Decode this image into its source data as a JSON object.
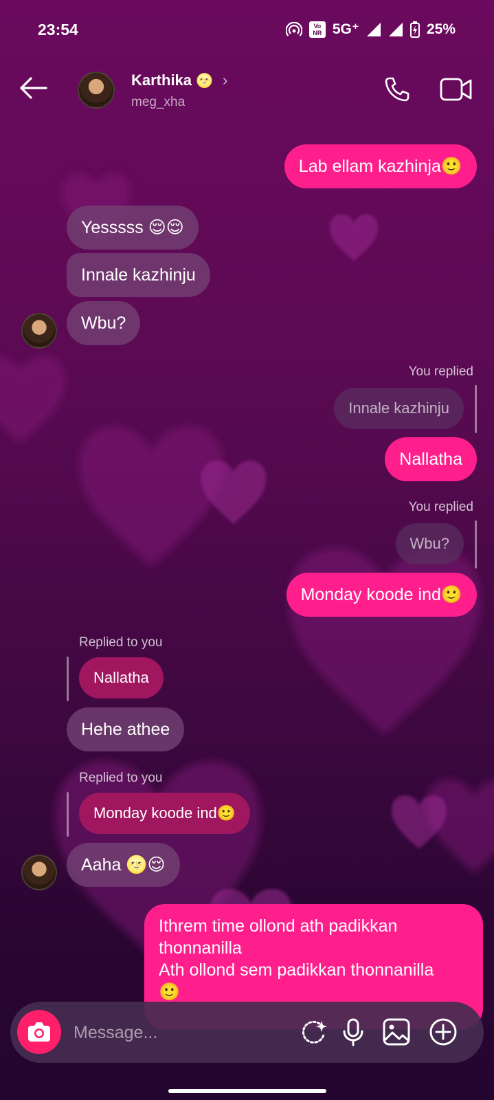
{
  "status": {
    "time": "23:54",
    "network": "5G⁺",
    "battery": "25%",
    "volte": "Vo NR"
  },
  "header": {
    "name": "Karthika",
    "name_emoji": "🌝",
    "username": "meg_xha"
  },
  "messages": {
    "m1": "Lab ellam kazhinja🙂",
    "m2": "Yesssss 😌😌",
    "m3": "Innale kazhinju",
    "m4": "Wbu?",
    "r1_label": "You replied",
    "r1_quote": "Innale kazhinju",
    "m5": "Nallatha",
    "r2_label": "You replied",
    "r2_quote": "Wbu?",
    "m6": "Monday koode ind🙂",
    "r3_label": "Replied to you",
    "r3_quote": "Nallatha",
    "m7": "Hehe athee",
    "r4_label": "Replied to you",
    "r4_quote": "Monday koode ind🙂",
    "m8": "Aaha 🌝😌",
    "m9_line1": "Ithrem time ollond ath padikkan",
    "m9_line2": "thonnanilla",
    "m9_line3": "Ath ollond sem padikkan thonnanilla",
    "m9_line4": "🙂"
  },
  "composer": {
    "placeholder": "Message..."
  },
  "colors": {
    "outgoing": "#ff1f8c",
    "camera": "#ff1f6a",
    "reply_quote_in": "#a0175f"
  }
}
